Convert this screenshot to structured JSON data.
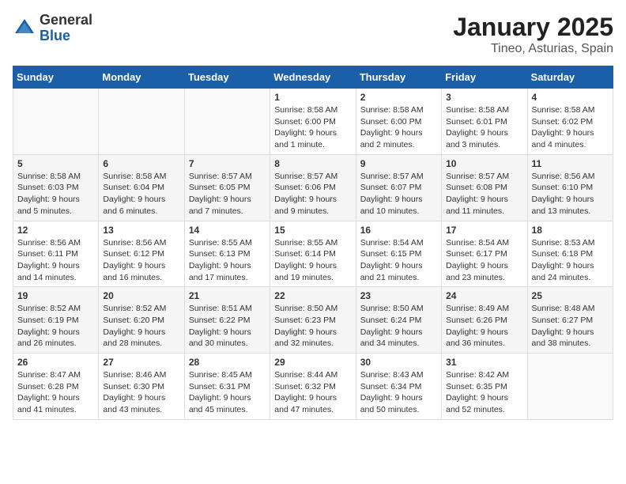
{
  "logo": {
    "general": "General",
    "blue": "Blue"
  },
  "title": "January 2025",
  "subtitle": "Tineo, Asturias, Spain",
  "weekdays": [
    "Sunday",
    "Monday",
    "Tuesday",
    "Wednesday",
    "Thursday",
    "Friday",
    "Saturday"
  ],
  "weeks": [
    [
      {
        "day": "",
        "info": ""
      },
      {
        "day": "",
        "info": ""
      },
      {
        "day": "",
        "info": ""
      },
      {
        "day": "1",
        "info": "Sunrise: 8:58 AM\nSunset: 6:00 PM\nDaylight: 9 hours\nand 1 minute."
      },
      {
        "day": "2",
        "info": "Sunrise: 8:58 AM\nSunset: 6:00 PM\nDaylight: 9 hours\nand 2 minutes."
      },
      {
        "day": "3",
        "info": "Sunrise: 8:58 AM\nSunset: 6:01 PM\nDaylight: 9 hours\nand 3 minutes."
      },
      {
        "day": "4",
        "info": "Sunrise: 8:58 AM\nSunset: 6:02 PM\nDaylight: 9 hours\nand 4 minutes."
      }
    ],
    [
      {
        "day": "5",
        "info": "Sunrise: 8:58 AM\nSunset: 6:03 PM\nDaylight: 9 hours\nand 5 minutes."
      },
      {
        "day": "6",
        "info": "Sunrise: 8:58 AM\nSunset: 6:04 PM\nDaylight: 9 hours\nand 6 minutes."
      },
      {
        "day": "7",
        "info": "Sunrise: 8:57 AM\nSunset: 6:05 PM\nDaylight: 9 hours\nand 7 minutes."
      },
      {
        "day": "8",
        "info": "Sunrise: 8:57 AM\nSunset: 6:06 PM\nDaylight: 9 hours\nand 9 minutes."
      },
      {
        "day": "9",
        "info": "Sunrise: 8:57 AM\nSunset: 6:07 PM\nDaylight: 9 hours\nand 10 minutes."
      },
      {
        "day": "10",
        "info": "Sunrise: 8:57 AM\nSunset: 6:08 PM\nDaylight: 9 hours\nand 11 minutes."
      },
      {
        "day": "11",
        "info": "Sunrise: 8:56 AM\nSunset: 6:10 PM\nDaylight: 9 hours\nand 13 minutes."
      }
    ],
    [
      {
        "day": "12",
        "info": "Sunrise: 8:56 AM\nSunset: 6:11 PM\nDaylight: 9 hours\nand 14 minutes."
      },
      {
        "day": "13",
        "info": "Sunrise: 8:56 AM\nSunset: 6:12 PM\nDaylight: 9 hours\nand 16 minutes."
      },
      {
        "day": "14",
        "info": "Sunrise: 8:55 AM\nSunset: 6:13 PM\nDaylight: 9 hours\nand 17 minutes."
      },
      {
        "day": "15",
        "info": "Sunrise: 8:55 AM\nSunset: 6:14 PM\nDaylight: 9 hours\nand 19 minutes."
      },
      {
        "day": "16",
        "info": "Sunrise: 8:54 AM\nSunset: 6:15 PM\nDaylight: 9 hours\nand 21 minutes."
      },
      {
        "day": "17",
        "info": "Sunrise: 8:54 AM\nSunset: 6:17 PM\nDaylight: 9 hours\nand 23 minutes."
      },
      {
        "day": "18",
        "info": "Sunrise: 8:53 AM\nSunset: 6:18 PM\nDaylight: 9 hours\nand 24 minutes."
      }
    ],
    [
      {
        "day": "19",
        "info": "Sunrise: 8:52 AM\nSunset: 6:19 PM\nDaylight: 9 hours\nand 26 minutes."
      },
      {
        "day": "20",
        "info": "Sunrise: 8:52 AM\nSunset: 6:20 PM\nDaylight: 9 hours\nand 28 minutes."
      },
      {
        "day": "21",
        "info": "Sunrise: 8:51 AM\nSunset: 6:22 PM\nDaylight: 9 hours\nand 30 minutes."
      },
      {
        "day": "22",
        "info": "Sunrise: 8:50 AM\nSunset: 6:23 PM\nDaylight: 9 hours\nand 32 minutes."
      },
      {
        "day": "23",
        "info": "Sunrise: 8:50 AM\nSunset: 6:24 PM\nDaylight: 9 hours\nand 34 minutes."
      },
      {
        "day": "24",
        "info": "Sunrise: 8:49 AM\nSunset: 6:26 PM\nDaylight: 9 hours\nand 36 minutes."
      },
      {
        "day": "25",
        "info": "Sunrise: 8:48 AM\nSunset: 6:27 PM\nDaylight: 9 hours\nand 38 minutes."
      }
    ],
    [
      {
        "day": "26",
        "info": "Sunrise: 8:47 AM\nSunset: 6:28 PM\nDaylight: 9 hours\nand 41 minutes."
      },
      {
        "day": "27",
        "info": "Sunrise: 8:46 AM\nSunset: 6:30 PM\nDaylight: 9 hours\nand 43 minutes."
      },
      {
        "day": "28",
        "info": "Sunrise: 8:45 AM\nSunset: 6:31 PM\nDaylight: 9 hours\nand 45 minutes."
      },
      {
        "day": "29",
        "info": "Sunrise: 8:44 AM\nSunset: 6:32 PM\nDaylight: 9 hours\nand 47 minutes."
      },
      {
        "day": "30",
        "info": "Sunrise: 8:43 AM\nSunset: 6:34 PM\nDaylight: 9 hours\nand 50 minutes."
      },
      {
        "day": "31",
        "info": "Sunrise: 8:42 AM\nSunset: 6:35 PM\nDaylight: 9 hours\nand 52 minutes."
      },
      {
        "day": "",
        "info": ""
      }
    ]
  ]
}
